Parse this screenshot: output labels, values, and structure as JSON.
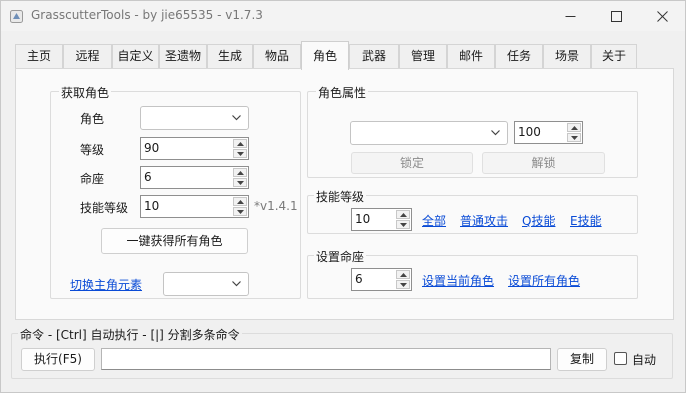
{
  "window": {
    "title": "GrasscutterTools  - by jie65535  - v1.7.3"
  },
  "tabs": [
    "主页",
    "远程",
    "自定义",
    "圣遗物",
    "生成",
    "物品",
    "角色",
    "武器",
    "管理",
    "邮件",
    "任务",
    "场景",
    "关于"
  ],
  "active_tab": "角色",
  "get_character": {
    "title": "获取角色",
    "character_label": "角色",
    "character_value": "",
    "level_label": "等级",
    "level_value": "90",
    "constellation_label": "命座",
    "constellation_value": "6",
    "skill_level_label": "技能等级",
    "skill_level_value": "10",
    "skill_level_note": "*v1.4.1",
    "get_all_button": "一键获得所有角色",
    "switch_element_link": "切换主角元素",
    "element_value": ""
  },
  "character_attrs": {
    "title": "角色属性",
    "attr_value": "",
    "amount_value": "100",
    "lock_button": "锁定",
    "unlock_button": "解锁"
  },
  "skill_level": {
    "title": "技能等级",
    "value": "10",
    "links": [
      "全部",
      "普通攻击",
      "Q技能",
      "E技能"
    ]
  },
  "set_constellation": {
    "title": "设置命座",
    "value": "6",
    "set_current_link": "设置当前角色",
    "set_all_link": "设置所有角色"
  },
  "command": {
    "title": "命令  - [Ctrl] 自动执行  - [|] 分割多条命令",
    "execute_button": "执行(F5)",
    "input_value": "",
    "copy_button": "复制",
    "auto_label": "自动",
    "auto_checked": false
  },
  "colors": {
    "link": "#0a4bd6",
    "window_bg": "#f0f0f0",
    "panel_bg": "#fafafa"
  }
}
